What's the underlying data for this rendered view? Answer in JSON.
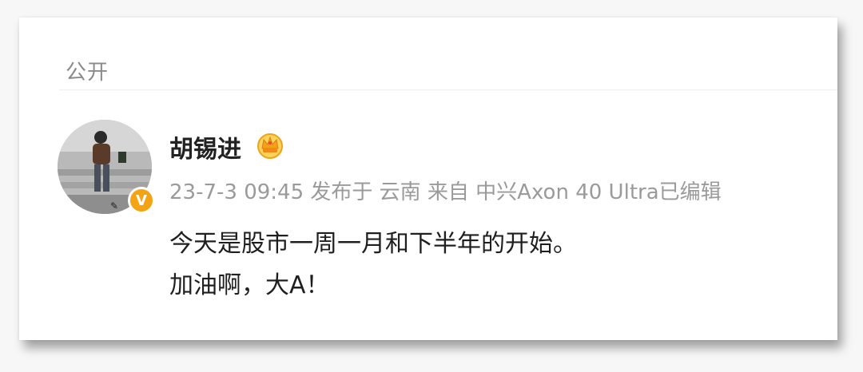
{
  "post": {
    "visibility_label": "公开",
    "author": {
      "name": "胡锡进",
      "verified_badge": "V"
    },
    "meta": {
      "timestamp": "23-7-3 09:45",
      "published_in": "发布于 云南",
      "source": "来自 中兴Axon 40 Ultra",
      "edited": "已编辑"
    },
    "content": {
      "line1": "今天是股市一周一月和下半年的开始。",
      "line2": "加油啊，大A！"
    }
  },
  "colors": {
    "verified_badge": "#f4a413",
    "meta_text": "#9a9a9a",
    "body_text": "#1f1f1f"
  },
  "icons": {
    "member": "crown-member-icon",
    "verified": "verified-v-icon"
  }
}
